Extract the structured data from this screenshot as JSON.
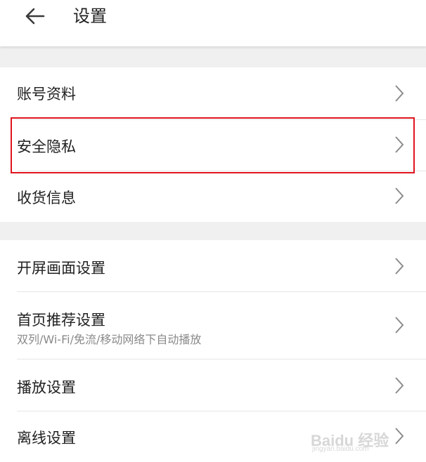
{
  "header": {
    "title": "设置",
    "back_icon": "arrow-left-icon"
  },
  "groups": [
    {
      "items": [
        {
          "label": "账号资料"
        },
        {
          "label": "安全隐私",
          "highlighted": true
        },
        {
          "label": "收货信息"
        }
      ]
    },
    {
      "items": [
        {
          "label": "开屏画面设置"
        },
        {
          "label": "首页推荐设置",
          "sublabel": "双列/Wi-Fi/免流/移动网络下自动播放"
        },
        {
          "label": "播放设置"
        },
        {
          "label": "离线设置"
        }
      ]
    }
  ],
  "watermark": {
    "brand": "Baidu 经验",
    "url": "jingyan.baidu.com"
  },
  "colors": {
    "highlight_border": "#e0141e",
    "section_gap": "#f0f0f0",
    "divider": "#e6e6e6",
    "text_primary": "#1f1f1f",
    "text_secondary": "#8a8a8a"
  }
}
